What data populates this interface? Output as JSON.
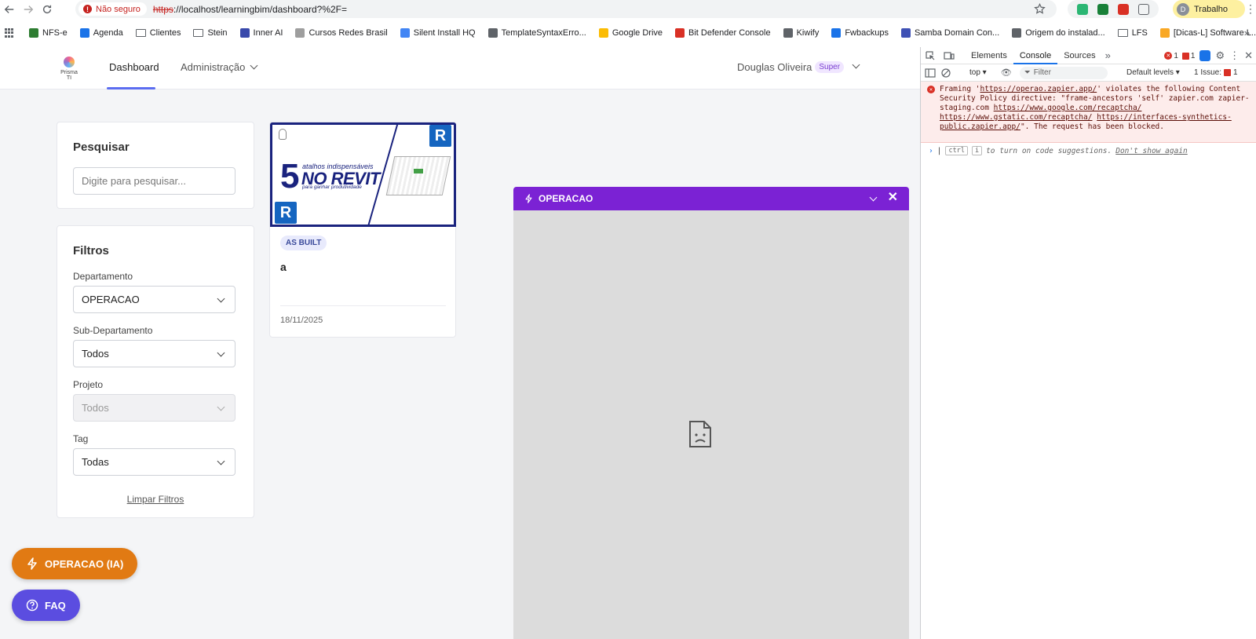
{
  "browser": {
    "security_label": "Não seguro",
    "url_scheme": "https",
    "url_rest": "://localhost/learningbim/dashboard?%2F=",
    "profile_initial": "D",
    "profile_label": "Trabalho"
  },
  "bookmarks": [
    {
      "label": "NFS-e",
      "color": "#2e7d32",
      "type": "site"
    },
    {
      "label": "Agenda",
      "color": "#1a73e8",
      "type": "site"
    },
    {
      "label": "Clientes",
      "type": "folder"
    },
    {
      "label": "Stein",
      "type": "folder"
    },
    {
      "label": "Inner AI",
      "color": "#3949ab",
      "type": "site"
    },
    {
      "label": "Cursos Redes Brasil",
      "color": "#9e9e9e",
      "type": "site"
    },
    {
      "label": "Silent Install HQ",
      "color": "#4285f4",
      "type": "site"
    },
    {
      "label": "TemplateSyntaxErro...",
      "color": "#5f6368",
      "type": "site"
    },
    {
      "label": "Google Drive",
      "color": "#fbbc04",
      "type": "site"
    },
    {
      "label": "Bit Defender Console",
      "color": "#d93025",
      "type": "site"
    },
    {
      "label": "Kiwify",
      "color": "#5f6368",
      "type": "site"
    },
    {
      "label": "Fwbackups",
      "color": "#1a73e8",
      "type": "site"
    },
    {
      "label": "Samba Domain Con...",
      "color": "#3f51b5",
      "type": "site"
    },
    {
      "label": "Origem do instalad...",
      "color": "#5f6368",
      "type": "site"
    },
    {
      "label": "LFS",
      "type": "folder"
    },
    {
      "label": "[Dicas-L] Software L...",
      "color": "#f9a825",
      "type": "site"
    }
  ],
  "app": {
    "logo_text": "Prisma TI",
    "nav_dashboard": "Dashboard",
    "nav_admin": "Administração",
    "user_name": "Douglas Oliveira",
    "user_badge": "Super",
    "search": {
      "title": "Pesquisar",
      "placeholder": "Digite para pesquisar..."
    },
    "filters": {
      "title": "Filtros",
      "dept_label": "Departamento",
      "dept_value": "OPERACAO",
      "subdept_label": "Sub-Departamento",
      "subdept_value": "Todos",
      "project_label": "Projeto",
      "project_value": "Todos",
      "tag_label": "Tag",
      "tag_value": "Todas",
      "clear": "Limpar Filtros"
    },
    "article": {
      "thumb_num": "5",
      "thumb_line1": "atalhos indispensáveis",
      "thumb_line2": "NO REVIT",
      "thumb_line3": "para ganhar produtividade",
      "revit_letter": "R",
      "tag": "AS BUILT",
      "title": "a",
      "date": "18/11/2025"
    },
    "widget": {
      "title": "OPERACAO",
      "accent": "#7b22d4"
    },
    "btn_ai": "OPERACAO (IA)",
    "btn_faq": "FAQ"
  },
  "devtools": {
    "tabs": [
      "Elements",
      "Console",
      "Sources"
    ],
    "active_tab": "Console",
    "error_count": "1",
    "issue_flag_count": "1",
    "context": "top",
    "filter_placeholder": "Filter",
    "levels": "Default levels",
    "issues_label": "1 Issue:",
    "issues_count": "1",
    "error": {
      "p1": "Framing '",
      "link1": "https://operao.zapier.app/",
      "p2": "' violates the following Content Security Policy directive: \"frame-ancestors 'self' zapier.com zapier-staging.com ",
      "link2": "https://www.google.com/recaptcha/",
      "link3": "https://www.gstatic.com/recaptcha/",
      "link4": "https://interfaces-synthetics-public.zapier.app/",
      "p3": "\". The request has been blocked."
    },
    "prompt_kbd1": "ctrl",
    "prompt_kbd2": "i",
    "prompt_text": "to turn on code suggestions.",
    "prompt_dont_show": "Don't show again"
  }
}
